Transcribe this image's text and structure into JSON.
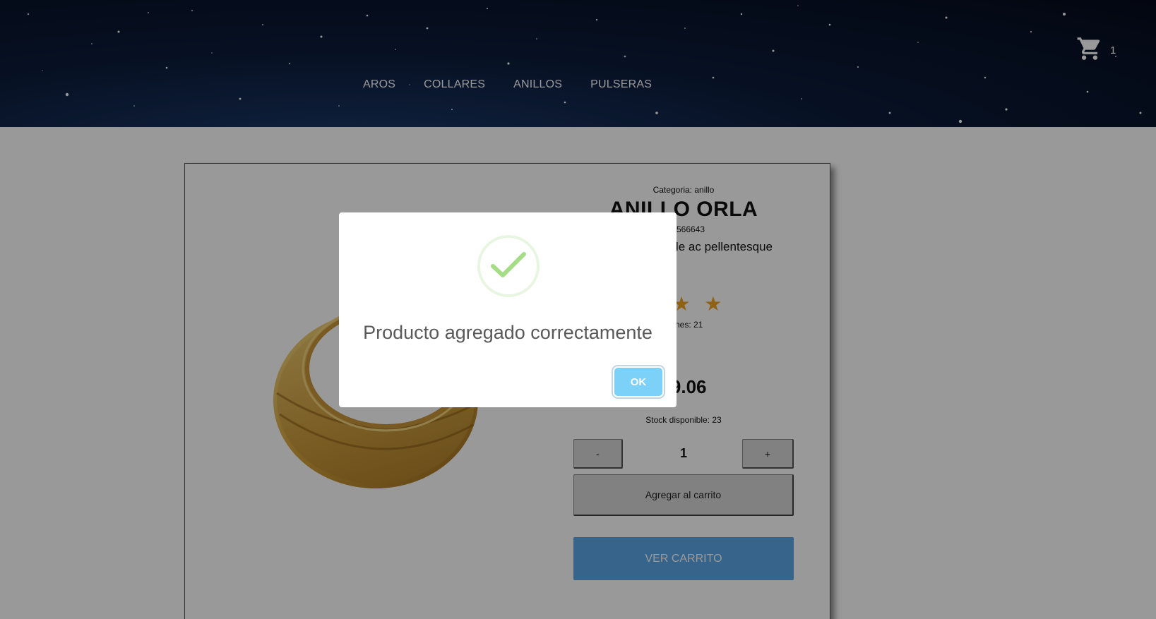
{
  "nav": {
    "items": [
      {
        "label": "AROS"
      },
      {
        "label": "COLLARES"
      },
      {
        "label": "ANILLOS"
      },
      {
        "label": "PULSERAS"
      }
    ]
  },
  "cart": {
    "count": "1"
  },
  "product": {
    "category": "Categoria: anillo",
    "title": "ANILLO ORLA",
    "code": "571566643",
    "description": "viverra pede ac pellentesque",
    "stars": "★ ★ ★",
    "ratings": "ciones: 21",
    "price": "19.06",
    "stock": "Stock disponible: 23",
    "quantity": "1",
    "minus_label": "-",
    "plus_label": "+",
    "add_to_cart_label": "Agregar al carrito",
    "view_cart_label": "VER CARRITO"
  },
  "modal": {
    "message": "Producto agregado correctamente",
    "ok_label": "OK"
  },
  "colors": {
    "star": "#f0a020",
    "view_cart_button": "#5da7e6",
    "ok_button": "#7cd1f9",
    "check": "#a5dc86"
  }
}
